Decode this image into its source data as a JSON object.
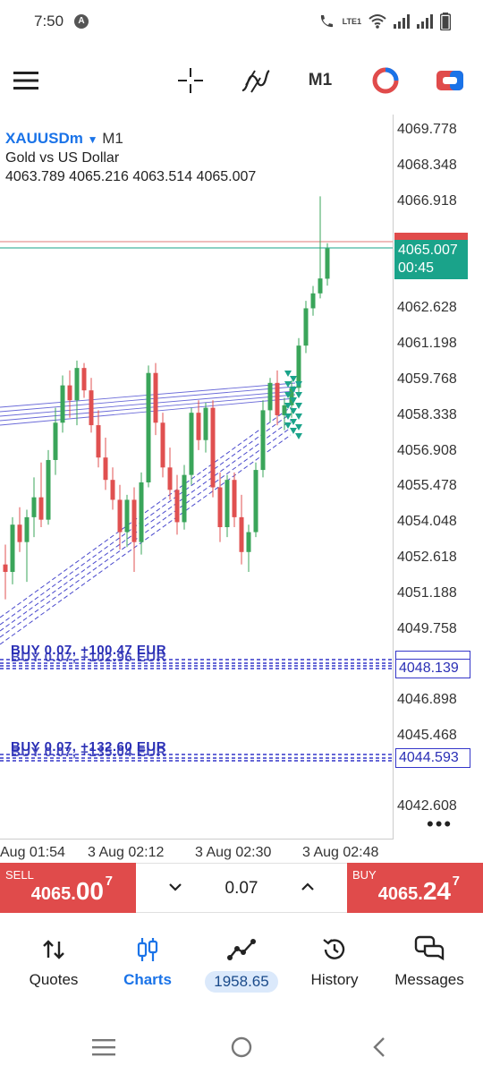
{
  "status_bar": {
    "time": "7:50",
    "a_badge": "A",
    "network_label": "LTE1"
  },
  "toolbar": {
    "timeframe": "M1",
    "icons": [
      "menu-icon",
      "crosshair-icon",
      "indicators-icon",
      "timeframe",
      "trade-history-icon",
      "one-click-trading-icon"
    ]
  },
  "chart": {
    "symbol": "XAUUSDm",
    "timeframe": "M1",
    "description": "Gold vs US Dollar",
    "ohlc": "4063.789 4065.216 4063.514 4065.007",
    "price_ticks": [
      "4069.778",
      "4068.348",
      "4066.918",
      "4062.628",
      "4061.198",
      "4059.768",
      "4058.338",
      "4056.908",
      "4055.478",
      "4054.048",
      "4052.618",
      "4051.188",
      "4049.758",
      "4046.898",
      "4045.468",
      "4042.608"
    ],
    "current_price": "4065.007",
    "timer": "00:45",
    "order_price_1": "4048.139",
    "order_price_2": "4044.593",
    "order_label_1": "BUY 0.07,  +100.47 EUR",
    "order_label_1b": "BUY 0.07,  +102.96 EUR",
    "order_label_2": "BUY 0.07,  +132.60 EUR",
    "order_label_2b": "BUY 0.07,  +135.04 EUR",
    "time_labels": [
      "Aug 01:54",
      "3 Aug 02:12",
      "3 Aug 02:30",
      "3 Aug 02:48"
    ],
    "colors": {
      "bull": "#3aa55a",
      "bear": "#e05050",
      "current_tag": "#1aa38a",
      "order_line": "#3436c9"
    }
  },
  "trade": {
    "sell_label": "SELL",
    "sell_price_main": "4065.",
    "sell_price_big": "00",
    "sell_price_sup": "7",
    "buy_label": "BUY",
    "buy_price_main": "4065.",
    "buy_price_big": "24",
    "buy_price_sup": "7",
    "volume": "0.07"
  },
  "nav": {
    "items": [
      {
        "label": "Quotes",
        "icon": "quotes-icon"
      },
      {
        "label": "Charts",
        "icon": "charts-icon"
      },
      {
        "label": "1958.65",
        "icon": "trade-icon"
      },
      {
        "label": "History",
        "icon": "history-icon"
      },
      {
        "label": "Messages",
        "icon": "messages-icon"
      }
    ],
    "active": "Charts"
  }
}
